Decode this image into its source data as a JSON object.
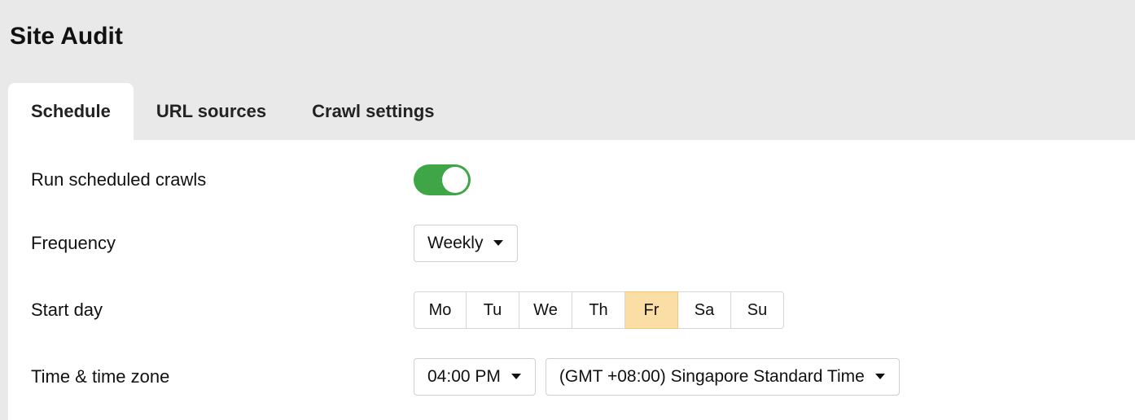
{
  "page_title": "Site Audit",
  "tabs": [
    {
      "label": "Schedule",
      "active": true
    },
    {
      "label": "URL sources",
      "active": false
    },
    {
      "label": "Crawl settings",
      "active": false
    }
  ],
  "schedule": {
    "run_scheduled_label": "Run scheduled crawls",
    "run_scheduled_enabled": true,
    "frequency_label": "Frequency",
    "frequency_value": "Weekly",
    "start_day_label": "Start day",
    "days": [
      "Mo",
      "Tu",
      "We",
      "Th",
      "Fr",
      "Sa",
      "Su"
    ],
    "selected_day": "Fr",
    "time_label": "Time & time zone",
    "time_value": "04:00 PM",
    "timezone_value": "(GMT +08:00) Singapore Standard Time"
  }
}
